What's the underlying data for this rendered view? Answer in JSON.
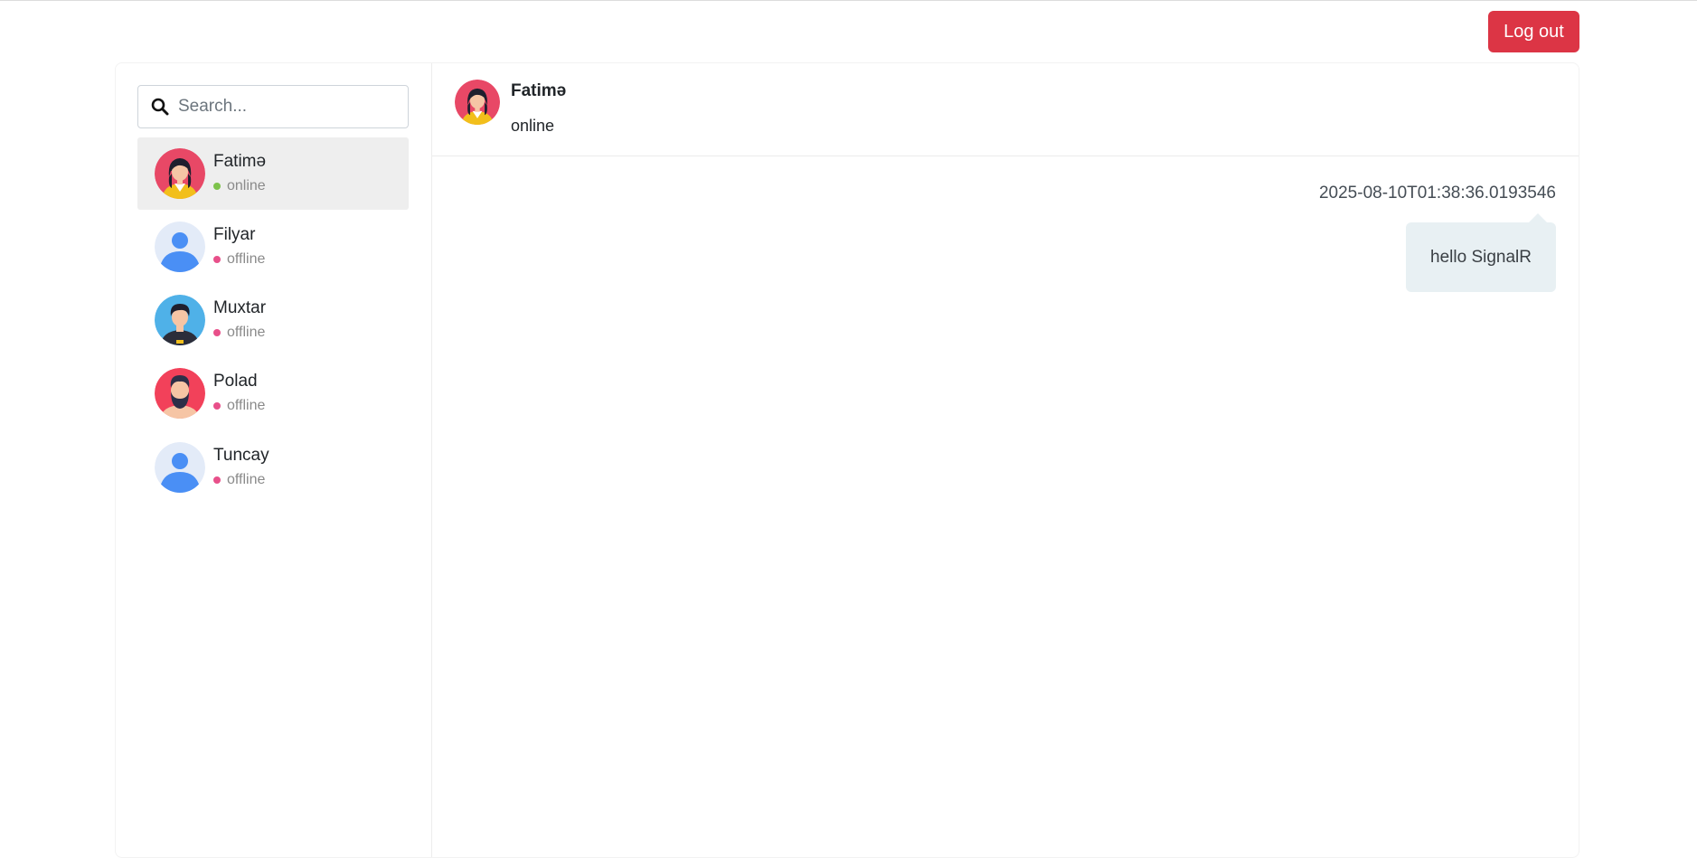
{
  "header": {
    "logout_label": "Log out"
  },
  "search": {
    "placeholder": "Search..."
  },
  "contacts": [
    {
      "name": "Fatimə",
      "status": "online",
      "avatar": "woman-avatar-icon",
      "active": true
    },
    {
      "name": "Filyar",
      "status": "offline",
      "avatar": "default-user-icon",
      "active": false
    },
    {
      "name": "Muxtar",
      "status": "offline",
      "avatar": "man-avatar-icon",
      "active": false
    },
    {
      "name": "Polad",
      "status": "offline",
      "avatar": "bearded-man-avatar-icon",
      "active": false
    },
    {
      "name": "Tuncay",
      "status": "offline",
      "avatar": "default-user-icon",
      "active": false
    }
  ],
  "chat": {
    "name": "Fatimə",
    "status": "online",
    "messages": [
      {
        "time": "2025-08-10T01:38:36.0193546",
        "text": "hello SignalR"
      }
    ]
  },
  "colors": {
    "logout": "#dc3545",
    "online_dot": "#7dc24b",
    "offline_dot": "#e8508a",
    "bubble": "#e8f0f3",
    "active_row": "#eeeeee"
  }
}
